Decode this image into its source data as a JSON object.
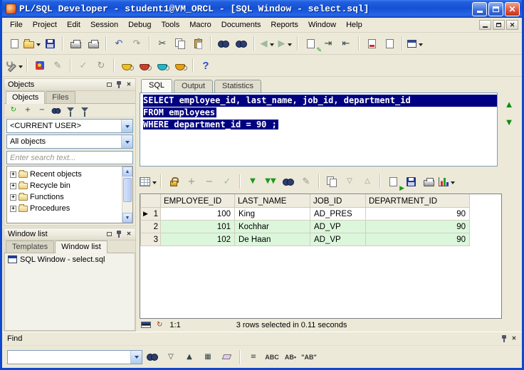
{
  "window": {
    "title": "PL/SQL Developer - student1@VM_ORCL - [SQL Window - select.sql]"
  },
  "menu": {
    "items": [
      "File",
      "Project",
      "Edit",
      "Session",
      "Debug",
      "Tools",
      "Macro",
      "Documents",
      "Reports",
      "Window",
      "Help"
    ]
  },
  "icons": {
    "undo": "↶",
    "redo": "↷",
    "cut": "✂",
    "back": "◀",
    "forward": "▶",
    "refresh": "↻",
    "plus": "+",
    "minus": "−",
    "check": "✓",
    "indent": "⇥",
    "outdent": "⇤",
    "pencil": "✎",
    "help": "?",
    "close": "✕",
    "up_arrow": "▲",
    "down_arrow": "▼",
    "tri_down": "▽",
    "tri_up": "△",
    "double_down": "▼▼",
    "mark_all": "▦",
    "list_lines": "≡",
    "row_marker": "▶",
    "status_refresh": "↻"
  },
  "objects_panel": {
    "title": "Objects",
    "tabs": [
      "Objects",
      "Files"
    ],
    "schema_select": "<CURRENT USER>",
    "object_filter_select": "All objects",
    "search_placeholder": "Enter search text...",
    "tree_items": [
      "Recent objects",
      "Recycle bin",
      "Functions",
      "Procedures"
    ]
  },
  "window_list_panel": {
    "title": "Window list",
    "tabs": [
      "Templates",
      "Window list"
    ],
    "items": [
      "SQL Window - select.sql"
    ]
  },
  "sql_window": {
    "tabs": [
      "SQL",
      "Output",
      "Statistics"
    ],
    "editor_lines": [
      "SELECT employee_id, last_name, job_id, department_id",
      "FROM employees",
      "WHERE department_id = 90 ;"
    ],
    "status": {
      "cursor": "1:1",
      "message": "3 rows selected in 0.11 seconds"
    }
  },
  "results_grid": {
    "columns": [
      "EMPLOYEE_ID",
      "LAST_NAME",
      "JOB_ID",
      "DEPARTMENT_ID"
    ],
    "rows": [
      {
        "n": "1",
        "employee_id": "100",
        "last_name": "King",
        "job_id": "AD_PRES",
        "department_id": "90"
      },
      {
        "n": "2",
        "employee_id": "101",
        "last_name": "Kochhar",
        "job_id": "AD_VP",
        "department_id": "90"
      },
      {
        "n": "3",
        "employee_id": "102",
        "last_name": "De Haan",
        "job_id": "AD_VP",
        "department_id": "90"
      }
    ]
  },
  "find_panel": {
    "title": "Find",
    "labels": {
      "abc": "ABC",
      "ab_word": "AB▪",
      "ab_quoted": "\"AB\""
    }
  },
  "colors": {
    "selection": "#000080",
    "titlebar": "#2460D8",
    "row_green": "#DCF6DC",
    "chrome": "#ECE9D8"
  }
}
